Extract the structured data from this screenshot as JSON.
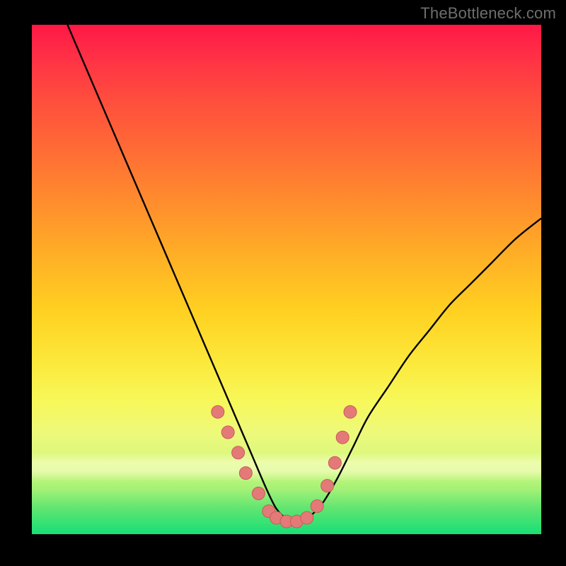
{
  "watermark": "TheBottleneck.com",
  "colors": {
    "curve": "#000000",
    "marker_fill": "#e47a78",
    "marker_stroke": "#c95a58"
  },
  "chart_data": {
    "type": "line",
    "title": "",
    "xlabel": "",
    "ylabel": "",
    "xlim": [
      0,
      100
    ],
    "ylim": [
      0,
      100
    ],
    "series": [
      {
        "name": "curve",
        "x": [
          7,
          10,
          13,
          16,
          19,
          22,
          25,
          28,
          31,
          34,
          37,
          40,
          43,
          46,
          48,
          50,
          52,
          54,
          57,
          60,
          63,
          66,
          70,
          74,
          78,
          82,
          86,
          90,
          95,
          100
        ],
        "y": [
          100,
          93,
          86,
          79,
          72,
          65,
          58,
          51,
          44,
          37,
          30,
          23,
          16,
          9,
          5,
          3,
          2,
          3,
          6,
          11,
          17,
          23,
          29,
          35,
          40,
          45,
          49,
          53,
          58,
          62
        ]
      }
    ],
    "markers": [
      {
        "x": 36.5,
        "y": 24
      },
      {
        "x": 38.5,
        "y": 20
      },
      {
        "x": 40.5,
        "y": 16
      },
      {
        "x": 42.0,
        "y": 12
      },
      {
        "x": 44.5,
        "y": 8
      },
      {
        "x": 46.5,
        "y": 4.5
      },
      {
        "x": 48.0,
        "y": 3.2
      },
      {
        "x": 50.0,
        "y": 2.5
      },
      {
        "x": 52.0,
        "y": 2.5
      },
      {
        "x": 54.0,
        "y": 3.2
      },
      {
        "x": 56.0,
        "y": 5.5
      },
      {
        "x": 58.0,
        "y": 9.5
      },
      {
        "x": 59.5,
        "y": 14
      },
      {
        "x": 61.0,
        "y": 19
      },
      {
        "x": 62.5,
        "y": 24
      }
    ]
  }
}
